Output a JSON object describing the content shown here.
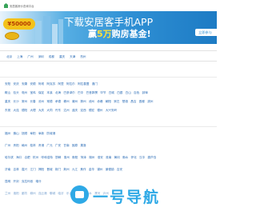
{
  "header": {
    "site_title": "安居客房价查询平台"
  },
  "banner": {
    "coin_amount": "¥50000",
    "title": "下载安居客手机APP",
    "subtitle_prefix": "赢",
    "subtitle_highlight": "5万",
    "subtitle_suffix": "购房基金!",
    "button_label": "立即参与"
  },
  "hot_cities": [
    "北京",
    "上海",
    "广州",
    "深圳",
    "成都",
    "重庆",
    "天津",
    "杭州"
  ],
  "groups": [
    {
      "rows": [
        [
          "安阳",
          "安庆",
          "安康",
          "安顺",
          "阿坝",
          "阿克苏",
          "阿里",
          "阿拉尔",
          "阿拉善盟",
          "澳门"
        ],
        [
          "鞍山",
          "包头",
          "亳州",
          "宝鸡",
          "保定",
          "本溪",
          "北海",
          "巴彦淖尔",
          "巴中",
          "巴音郭楞",
          "毕节",
          "白城",
          "白银",
          "白山",
          "百色",
          "蚌埠"
        ],
        [
          "重庆",
          "长沙",
          "常州",
          "长春",
          "沧州",
          "常德",
          "承德",
          "郴州",
          "潮州",
          "滁州",
          "池州",
          "赤峰",
          "朝阳",
          "崇左",
          "楚雄",
          "昌吉",
          "昌都",
          "滨州"
        ],
        [
          "东莞",
          "大连",
          "德阳",
          "大理",
          "大庆",
          "大同",
          "丹东",
          "达州",
          "迪庆",
          "定西",
          "德宏",
          "德州",
          "大兴安岭"
        ]
      ]
    },
    {
      "rows": [
        [
          "福州",
          "佛山",
          "抚顺",
          "阜阳",
          "阜新",
          "防城港"
        ],
        [
          "广州",
          "贵阳",
          "赣州",
          "桂林",
          "贵港",
          "广元",
          "广安",
          "甘南",
          "固原",
          "果洛"
        ],
        [
          "哈尔滨",
          "海口",
          "合肥",
          "杭州",
          "呼和浩特",
          "邯郸",
          "惠州",
          "衡阳",
          "菏泽",
          "湖州",
          "淮安",
          "淮南",
          "黄冈",
          "衡水",
          "怀化",
          "汉中",
          "葫芦岛"
        ],
        [
          "济南",
          "吉林",
          "嘉兴",
          "江门",
          "揭阳",
          "晋城",
          "荆门",
          "荆州",
          "九江",
          "焦作",
          "金华",
          "锦州",
          "景德镇",
          "吉安"
        ],
        [
          "昆明",
          "开封",
          "克拉玛依",
          "喀什"
        ],
        [
          "兰州",
          "洛阳",
          "廊坊",
          "柳州",
          "连云港",
          "聊城",
          "临沂",
          "乐山",
          "丽江",
          "六盘水",
          "漯河",
          "泸州"
        ]
      ]
    }
  ],
  "watermark": {
    "text": "一号导航"
  },
  "colors": {
    "link": "#2a6bb5",
    "accent": "#e46f17",
    "brand": "#2e8fd4",
    "watermark": "#2ea9e6"
  }
}
